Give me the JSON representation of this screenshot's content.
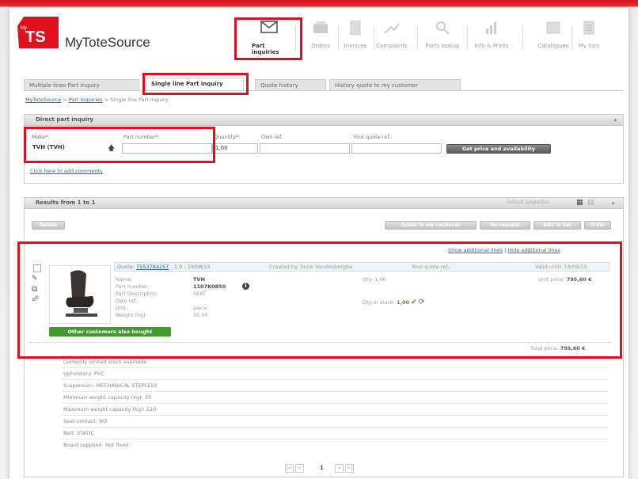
{
  "brand": {
    "badge_prefix": "My",
    "badge": "TS",
    "name_my": "My",
    "name_rest": "ToteSource"
  },
  "nav": [
    {
      "label": "Part inquiries",
      "icon": "envelope-icon",
      "active": true
    },
    {
      "label": "Orders",
      "icon": "orders-icon"
    },
    {
      "label": "Invoices",
      "icon": "invoice-icon"
    },
    {
      "label": "Complaints",
      "icon": "complaint-icon"
    },
    {
      "label": "Parts lookup",
      "icon": "search-icon"
    },
    {
      "label": "Info & Prints",
      "icon": "chart-icon"
    },
    {
      "label": "Catalogues",
      "icon": "catalogue-icon"
    },
    {
      "label": "My lists",
      "icon": "list-icon"
    }
  ],
  "tabs": [
    {
      "label": "Multiple lines Part inquiry"
    },
    {
      "label": "Single line Part inquiry",
      "active": true
    },
    {
      "label": "Quote history"
    },
    {
      "label": "History quote to my customer"
    }
  ],
  "breadcrumb": {
    "home": "MyToteSource",
    "sep1": ">",
    "section": "Part inquiries",
    "sep2": ">",
    "current": "Single line Part inquiry"
  },
  "direct": {
    "title": "Direct part inquiry",
    "make_label": "Make*:",
    "make_value": "TVH (TVH)",
    "part_label": "Part number*:",
    "part_value": "",
    "qty_label": "Quantity*:",
    "qty_value": "1,00",
    "ownref_label": "Own ref.",
    "ownref_value": "",
    "quoteref_label": "Your quote ref.:",
    "quoteref_value": "",
    "submit": "Get price and availability",
    "comments_link": "Click here to add comments"
  },
  "results": {
    "title": "Results from 1 to 1",
    "settings": "Default properties",
    "delete": "Delete",
    "quote_customer": "Quote to my customer",
    "new_quote": "Re-request",
    "add_basket": "Add to list",
    "order": "Order",
    "show_info": "Show additional lines",
    "info_sep": " | ",
    "hide_info": "Hide additional lines",
    "quote_label": "Quote:",
    "quote_no": "7553784257",
    "quote_date": "- 1,0 - 19/08/15",
    "created_by": "Created by: Sune Vandenberghe",
    "your_ref": "Your quote ref.:",
    "valid_until": "Valid until: 19/09/15",
    "fields": [
      {
        "label": "Name:",
        "value": "TVH"
      },
      {
        "label": "Part number:",
        "value": "1107K0850"
      },
      {
        "label": "Part Description:",
        "value": "SEAT"
      },
      {
        "label": "Own ref.:",
        "value": ""
      },
      {
        "label": "Unit:",
        "value": "piece"
      },
      {
        "label": "Weight (kg):",
        "value": "35.00"
      }
    ],
    "qty": "Qty: 1,00",
    "qty_stock_label": "Qty in stock:",
    "qty_stock_value": "1,00",
    "unit_price_label": "Unit price:",
    "unit_price": "795,60 €",
    "other_customers": "Other customers also bought",
    "total_label": "Total price:",
    "total": "795,60 €"
  },
  "specs": [
    "Currently limited stock available",
    "Upholstery: PVC",
    "Suspension: MECHANICAL STEPLESS",
    "Minimum weight capacity (kg): 50",
    "Maximum weight capacity (kg): 120",
    "Seat contact: NO",
    "Belt: STATIC",
    "Board supplied: Not fixed"
  ],
  "pager": {
    "first": "|<",
    "prev": "<",
    "page": "1",
    "next": ">",
    "last": ">|"
  },
  "colors": {
    "brand_red": "#e0101e",
    "highlight": "#e0101e",
    "stock_green": "#3f9b2a"
  }
}
